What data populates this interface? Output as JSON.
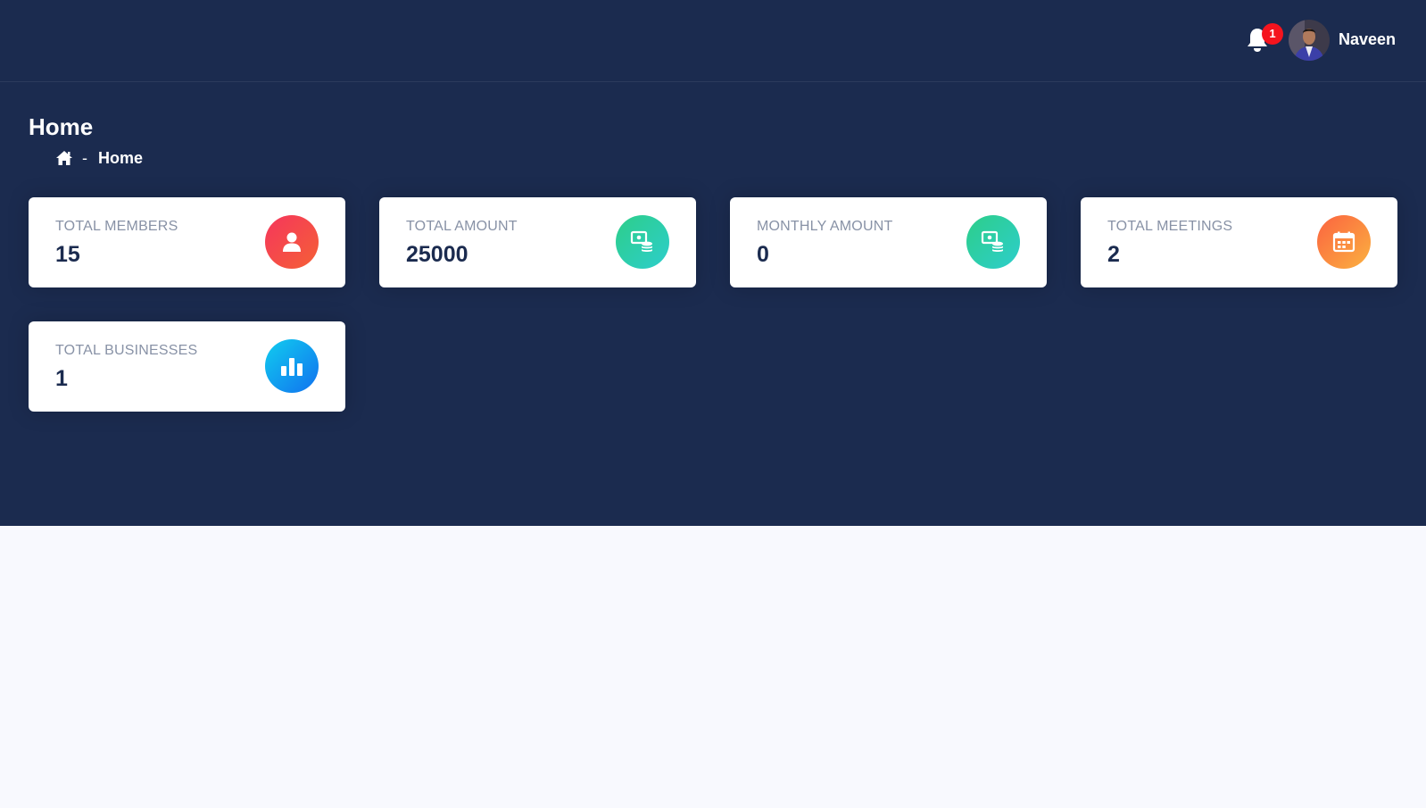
{
  "header": {
    "notification_count": "1",
    "username": "Naveen"
  },
  "page": {
    "title": "Home",
    "breadcrumb": {
      "separator": "-",
      "current": "Home"
    }
  },
  "stats": [
    {
      "label": "TOTAL MEMBERS",
      "value": "15",
      "icon": "user-icon",
      "color": "#f5365c"
    },
    {
      "label": "TOTAL AMOUNT",
      "value": "25000",
      "icon": "money-coins-icon",
      "color": "#2dce89"
    },
    {
      "label": "MONTHLY AMOUNT",
      "value": "0",
      "icon": "money-coins-icon",
      "color": "#2dce89"
    },
    {
      "label": "TOTAL MEETINGS",
      "value": "2",
      "icon": "calendar-icon",
      "color": "#fb6340"
    },
    {
      "label": "TOTAL BUSINESSES",
      "value": "1",
      "icon": "bar-chart-icon",
      "color": "#11cdef"
    }
  ],
  "theme": {
    "header_bg": "#1b2b4f",
    "page_bg": "#f8f9fe",
    "badge_red": "#f5141e"
  }
}
